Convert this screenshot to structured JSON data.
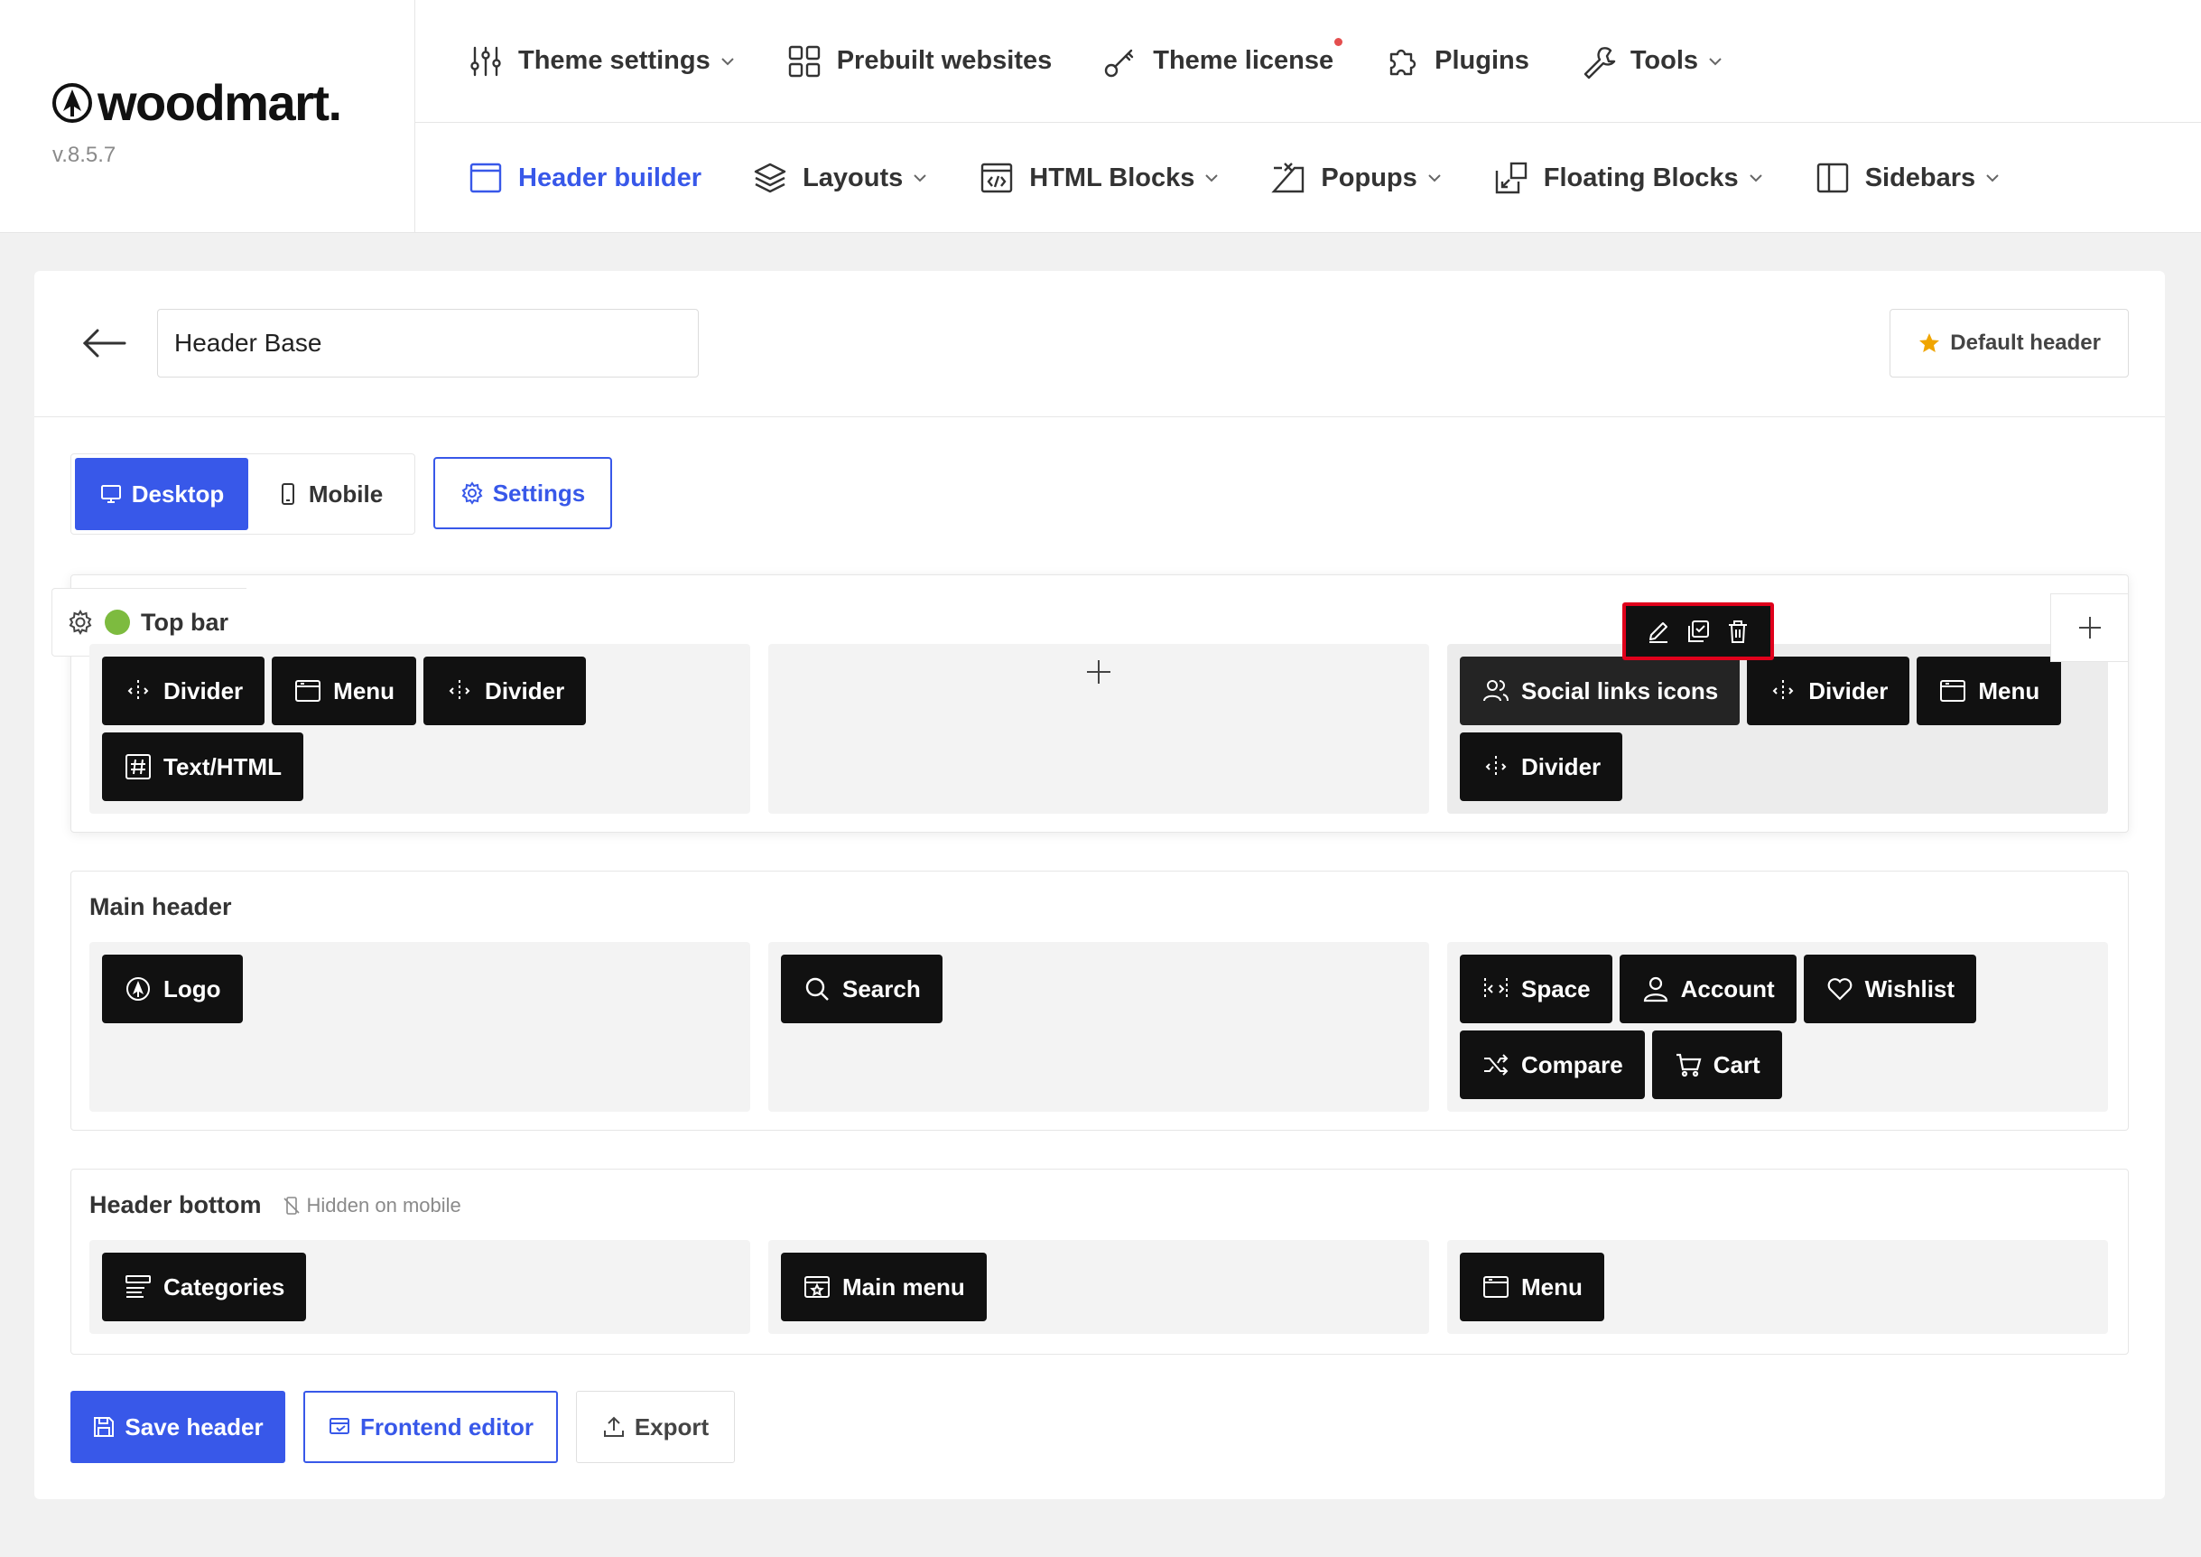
{
  "brand": {
    "name": "woodmart.",
    "version": "v.8.5.7"
  },
  "nav_primary": [
    {
      "label": "Theme settings",
      "icon": "sliders-icon",
      "dropdown": true
    },
    {
      "label": "Prebuilt websites",
      "icon": "grid-icon",
      "dropdown": false
    },
    {
      "label": "Theme license",
      "icon": "key-icon",
      "dropdown": false,
      "notification": true
    },
    {
      "label": "Plugins",
      "icon": "puzzle-icon",
      "dropdown": false
    },
    {
      "label": "Tools",
      "icon": "wrench-icon",
      "dropdown": true
    }
  ],
  "nav_secondary": [
    {
      "label": "Header builder",
      "icon": "window-icon",
      "active": true,
      "dropdown": false
    },
    {
      "label": "Layouts",
      "icon": "layers-icon",
      "dropdown": true
    },
    {
      "label": "HTML Blocks",
      "icon": "code-block-icon",
      "dropdown": true
    },
    {
      "label": "Popups",
      "icon": "popup-icon",
      "dropdown": true
    },
    {
      "label": "Floating Blocks",
      "icon": "floating-block-icon",
      "dropdown": true
    },
    {
      "label": "Sidebars",
      "icon": "sidebar-icon",
      "dropdown": true
    }
  ],
  "editor": {
    "header_name": "Header Base",
    "default_button": "Default header",
    "tabs": {
      "desktop": "Desktop",
      "mobile": "Mobile"
    },
    "settings_button": "Settings"
  },
  "rows": {
    "top": {
      "title": "Top bar",
      "left": [
        {
          "label": "Divider",
          "icon": "divider-icon"
        },
        {
          "label": "Menu",
          "icon": "menu-window-icon"
        },
        {
          "label": "Divider",
          "icon": "divider-icon"
        },
        {
          "label": "Text/HTML",
          "icon": "hash-icon"
        }
      ],
      "right": [
        {
          "label": "Social links icons",
          "icon": "users-icon"
        },
        {
          "label": "Divider",
          "icon": "divider-icon"
        },
        {
          "label": "Menu",
          "icon": "menu-window-icon"
        },
        {
          "label": "Divider",
          "icon": "divider-icon"
        }
      ]
    },
    "main": {
      "title": "Main header",
      "left": [
        {
          "label": "Logo",
          "icon": "logo-icon"
        }
      ],
      "center": [
        {
          "label": "Search",
          "icon": "search-icon"
        }
      ],
      "right": [
        {
          "label": "Space",
          "icon": "space-icon"
        },
        {
          "label": "Account",
          "icon": "user-icon"
        },
        {
          "label": "Wishlist",
          "icon": "heart-icon"
        },
        {
          "label": "Compare",
          "icon": "shuffle-icon"
        },
        {
          "label": "Cart",
          "icon": "cart-icon"
        }
      ]
    },
    "bottom": {
      "title": "Header bottom",
      "note": "Hidden on mobile",
      "left": [
        {
          "label": "Categories",
          "icon": "categories-icon"
        }
      ],
      "center": [
        {
          "label": "Main menu",
          "icon": "main-menu-icon"
        }
      ],
      "right": [
        {
          "label": "Menu",
          "icon": "menu-window-icon"
        }
      ]
    }
  },
  "footer": {
    "save": "Save header",
    "frontend": "Frontend editor",
    "export": "Export"
  },
  "colors": {
    "accent": "#3858e9",
    "highlight": "#e0001b",
    "element_bg": "#111111",
    "status_green": "#7dbb3f"
  }
}
